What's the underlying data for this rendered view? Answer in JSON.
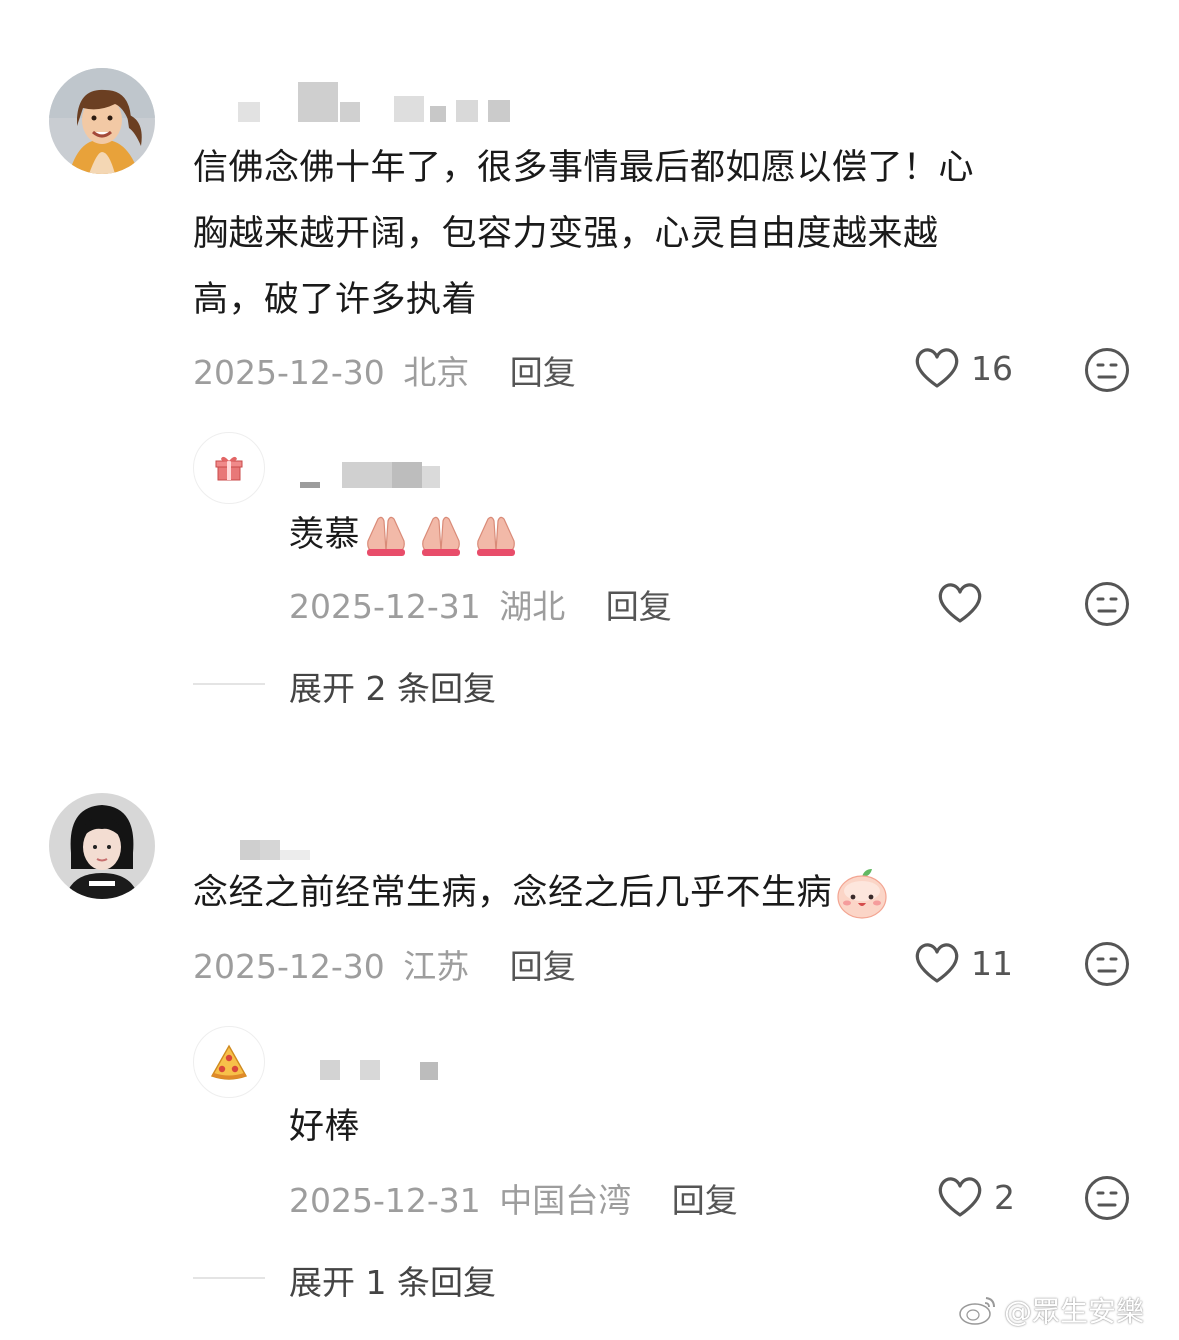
{
  "comments": [
    {
      "text_lines": [
        "信佛念佛十年了，很多事情最后都如愿以偿了！心",
        "胸越来越开阔，包容力变强，心灵自由度越来越",
        "高，破了许多执着"
      ],
      "date": "2025-12-30",
      "location": "北京",
      "reply_label": "回复",
      "likes": "16",
      "sub_reply": {
        "avatar_icon": "gift-icon",
        "text": "羡慕",
        "emoji": "pray-hands-emoji",
        "date": "2025-12-31",
        "location": "湖北",
        "reply_label": "回复",
        "likes": ""
      },
      "expand_label": "展开 2 条回复"
    },
    {
      "text_lines": [
        "念经之前经常生病，念经之后几乎不生病"
      ],
      "emoji": "peach-face-emoji",
      "date": "2025-12-30",
      "location": "江苏",
      "reply_label": "回复",
      "likes": "11",
      "sub_reply": {
        "avatar_icon": "pizza-icon",
        "text": "好棒",
        "date": "2025-12-31",
        "location": "中国台湾",
        "reply_label": "回复",
        "likes": "2"
      },
      "expand_label": "展开 1 条回复"
    }
  ],
  "watermark": "@眾生安樂",
  "colors": {
    "meta": "#9d9d9d",
    "text": "#1a1a1a",
    "line": "#e4e4e4"
  }
}
